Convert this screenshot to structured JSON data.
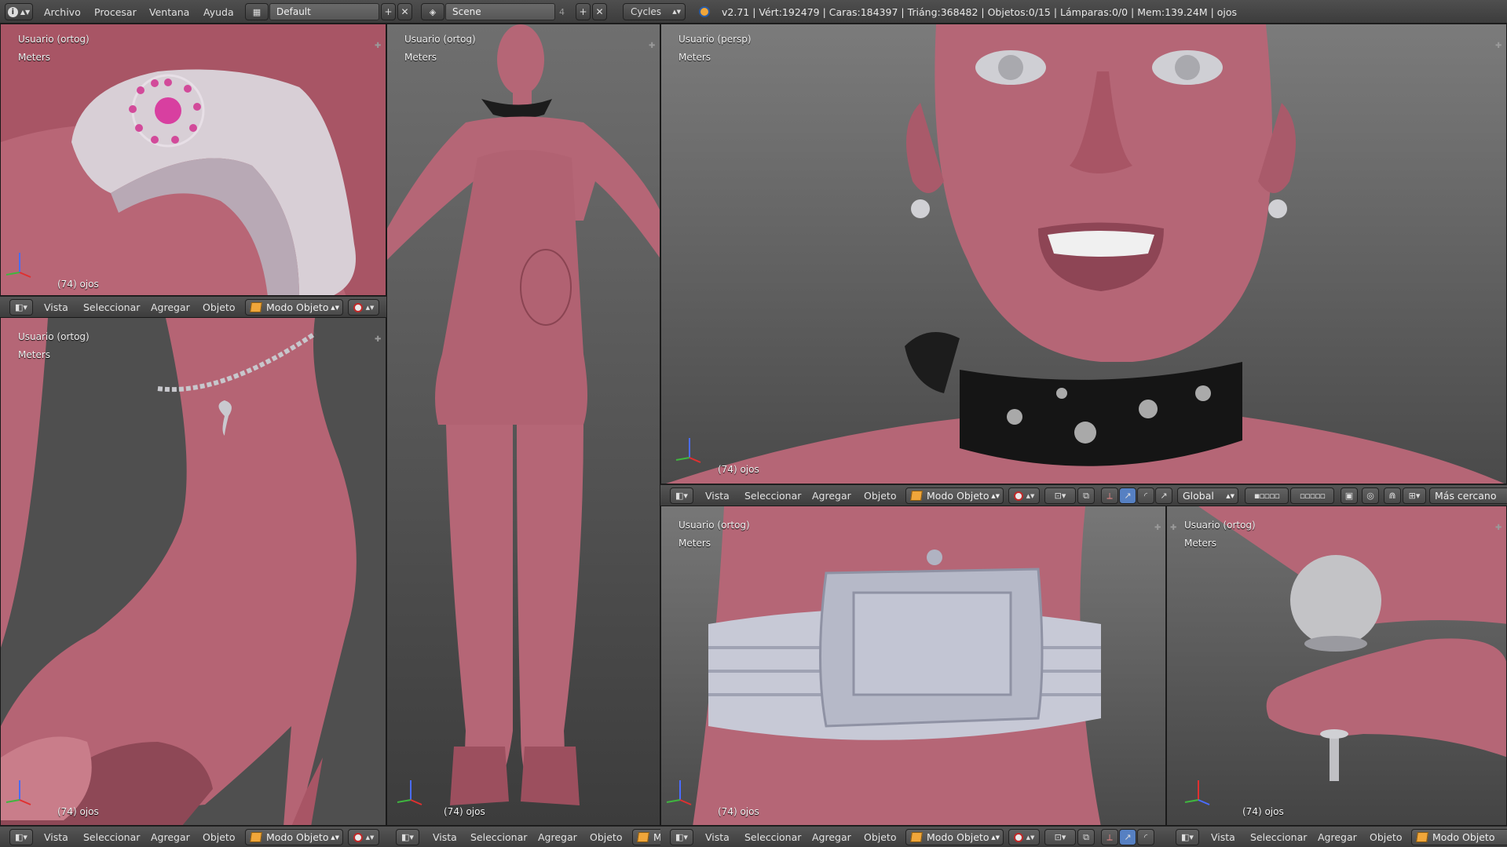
{
  "topbar": {
    "menus": [
      "Archivo",
      "Procesar",
      "Ventana",
      "Ayuda"
    ],
    "layout": "Default",
    "scene": "Scene",
    "scene_users": "4",
    "engine": "Cycles",
    "stats": "v2.71 | Vért:192479 | Caras:184397 | Triáng:368482 | Objetos:0/15 | Lámparas:0/0 | Mem:139.24M | ojos"
  },
  "viewports": {
    "top_left": {
      "view": "Usuario (ortog)",
      "units": "Meters",
      "object": "(74) ojos"
    },
    "bottom_left": {
      "view": "Usuario (ortog)",
      "units": "Meters",
      "object": "(74) ojos"
    },
    "middle": {
      "view": "Usuario (ortog)",
      "units": "Meters",
      "object": "(74) ojos"
    },
    "right_top": {
      "view": "Usuario (persp)",
      "units": "Meters",
      "object": "(74) ojos"
    },
    "right_bottom_left": {
      "view": "Usuario (ortog)",
      "units": "Meters",
      "object": "(74) ojos"
    },
    "right_bottom_right": {
      "view": "Usuario (ortog)",
      "units": "Meters",
      "object": "(74) ojos"
    }
  },
  "header": {
    "vista": "Vista",
    "seleccionar": "Seleccionar",
    "agregar": "Agregar",
    "objeto": "Objeto",
    "mode": "Modo Objeto",
    "mode_short": "M",
    "orientation": "Global",
    "snap": "Más cercano"
  },
  "colors": {
    "skin": "#b46170",
    "viewport_bg": "#6e6e6e",
    "header": "#474747",
    "accent_orange": "#f0a63a"
  }
}
